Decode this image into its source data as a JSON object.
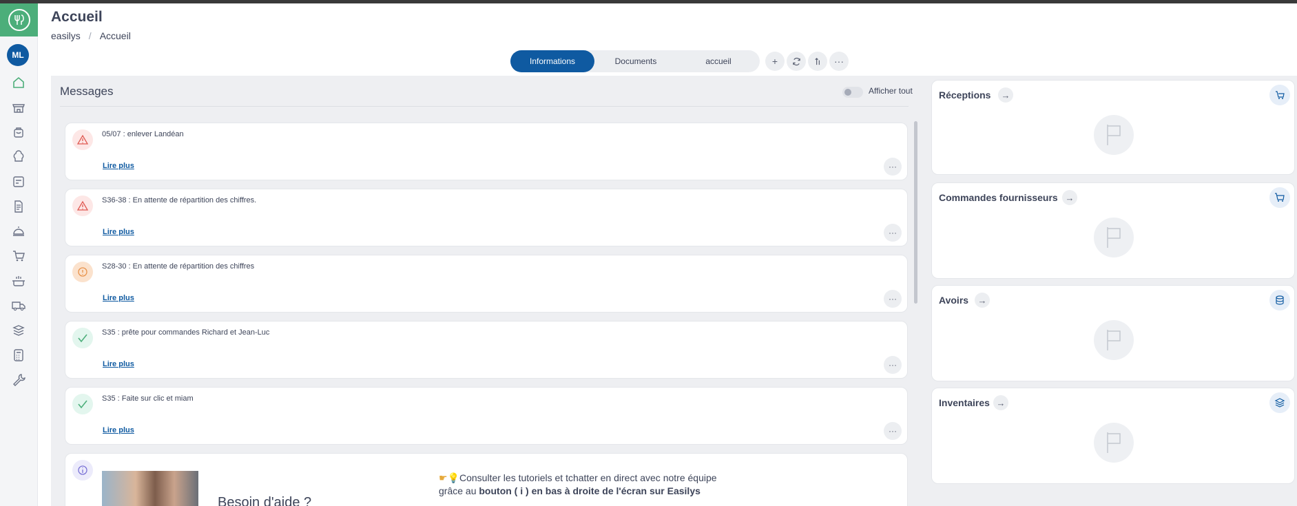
{
  "app": {
    "avatar_initials": "ML",
    "brand_color": "#4cae7a",
    "accent_color": "#0f5aa1"
  },
  "header": {
    "title": "Accueil",
    "breadcrumb": [
      "easilys",
      "Accueil"
    ],
    "tabs": [
      {
        "label": "Informations",
        "active": true
      },
      {
        "label": "Documents",
        "active": false
      },
      {
        "label": "accueil",
        "active": false
      }
    ],
    "tools": [
      "plus-icon",
      "refresh-icon",
      "sort-icon",
      "more-icon"
    ]
  },
  "sidebar": {
    "items": [
      "home-icon",
      "store-icon",
      "bag-icon",
      "chef-hat-icon",
      "checklist-icon",
      "document-icon",
      "cloche-icon",
      "cart-icon",
      "cooking-pot-icon",
      "truck-icon",
      "stack-icon",
      "calculator-icon",
      "tools-icon"
    ]
  },
  "messages": {
    "title": "Messages",
    "toggle_label": "Afficher tout",
    "read_more": "Lire plus",
    "items": [
      {
        "text": "05/07 : enlever Landéan",
        "status": "warning"
      },
      {
        "text": "S36-38 : En attente de répartition des chiffres.",
        "status": "warning"
      },
      {
        "text": "S28-30 : En attente de répartition des chiffres",
        "status": "alert"
      },
      {
        "text": "S35 : prête pour commandes Richard et Jean-Luc",
        "status": "ok"
      },
      {
        "text": "S35 : Faite sur clic et miam",
        "status": "ok"
      }
    ],
    "help": {
      "title": "Besoin d'aide ?",
      "line1": "Consulter les tutoriels et tchatter en direct avec notre équipe",
      "line2_prefix": "grâce au ",
      "line2_bold": "bouton ( i ) en bas à droite de l'écran sur Easilys"
    }
  },
  "widgets": [
    {
      "title": "Réceptions",
      "icon": "reception-icon"
    },
    {
      "title": "Commandes fournisseurs",
      "icon": "cart-icon"
    },
    {
      "title": "Avoirs",
      "icon": "coins-icon"
    },
    {
      "title": "Inventaires",
      "icon": "stack-icon"
    }
  ]
}
